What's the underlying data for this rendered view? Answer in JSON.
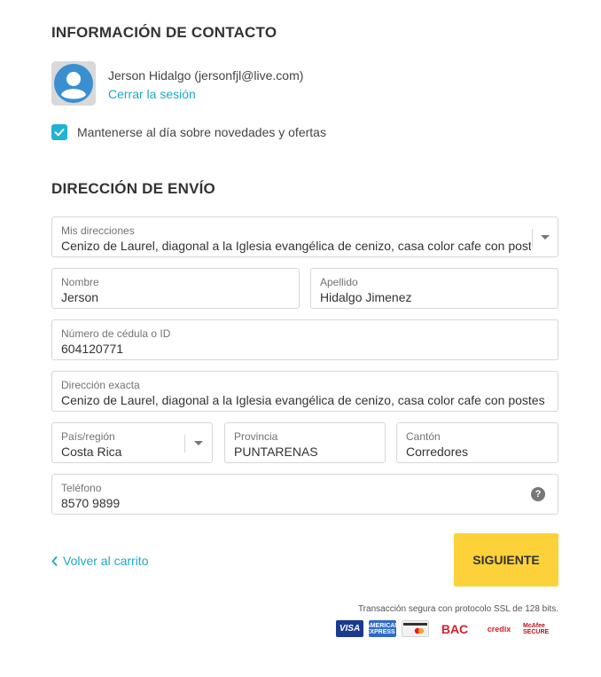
{
  "contact": {
    "title": "INFORMACIÓN DE CONTACTO",
    "user_name": "Jerson Hidalgo (jersonfjl@live.com)",
    "logout_label": "Cerrar la sesión",
    "newsletter_label": "Mantenerse al día sobre novedades y ofertas",
    "newsletter_checked": true
  },
  "shipping": {
    "title": "DIRECCIÓN DE ENVÍO",
    "saved_addresses": {
      "label": "Mis direcciones",
      "value": "Cenizo de Laurel, diagonal a la Iglesia evangélica de cenizo, casa color cafe con postes"
    },
    "first_name": {
      "label": "Nombre",
      "value": "Jerson"
    },
    "last_name": {
      "label": "Apellido",
      "value": "Hidalgo Jimenez"
    },
    "id_number": {
      "label": "Número de cédula o ID",
      "value": "604120771"
    },
    "address": {
      "label": "Dirección exacta",
      "value": "Cenizo de Laurel, diagonal a la Iglesia evangélica de cenizo, casa color cafe con postes ve"
    },
    "country": {
      "label": "País/región",
      "value": "Costa Rica"
    },
    "province": {
      "label": "Provincia",
      "value": "PUNTARENAS"
    },
    "canton": {
      "label": "Cantón",
      "value": "Corredores"
    },
    "phone": {
      "label": "Teléfono",
      "value": "8570 9899",
      "help_icon": "?"
    }
  },
  "footer": {
    "back_label": "Volver al carrito",
    "next_label": "SIGUIENTE",
    "ssl_text": "Transacción segura con protocolo SSL de 128 bits.",
    "payment_logos": {
      "visa": "VISA",
      "amex": "AMERICAN EXPRESS",
      "mastercard": "",
      "bac": "BAC",
      "credix": "credix",
      "mcafee": "McAfee SECURE"
    }
  },
  "colors": {
    "accent": "#1fa8c4",
    "checkbox": "#1fb3d6",
    "button": "#fdd13a",
    "border": "#d7d7d7"
  }
}
